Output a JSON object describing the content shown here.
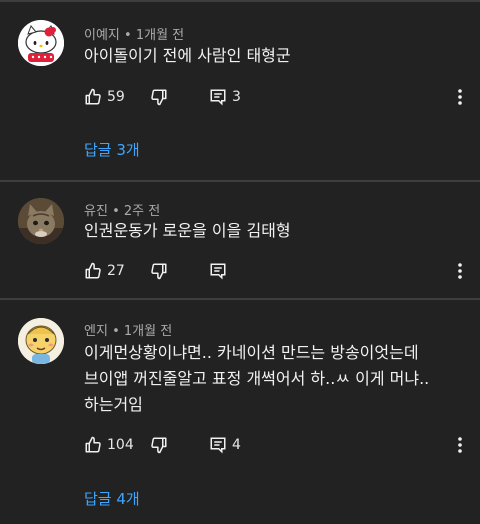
{
  "colors": {
    "background": "#222222",
    "text": "#f1f1f1",
    "meta_text": "#aaaaaa",
    "link": "#3ea6ff",
    "divider": "#3e3e3e"
  },
  "comments": [
    {
      "author": "이예지",
      "separator": "•",
      "time": "1개월 전",
      "text": "아이돌이기 전에 사람인 태형군",
      "likes": "59",
      "replies_count": "3",
      "replies_link": "답글 3개",
      "avatar": "hello-kitty-avatar"
    },
    {
      "author": "유진",
      "separator": "•",
      "time": "2주 전",
      "text": "인권운동가 로운을 이을 김태형",
      "likes": "27",
      "replies_count": "",
      "replies_link": "",
      "avatar": "cat-photo-avatar"
    },
    {
      "author": "엔지",
      "separator": "•",
      "time": "1개월 전",
      "text": "이게먼상황이냐면.. 카네이션 만드는 방송이엇는데\n브이앱 꺼진줄알고 표정 개썩어서 하..ㅆ 이게 머냐..\n하는거임",
      "likes": "104",
      "replies_count": "4",
      "replies_link": "답글 4개",
      "avatar": "cartoon-character-avatar"
    }
  ]
}
